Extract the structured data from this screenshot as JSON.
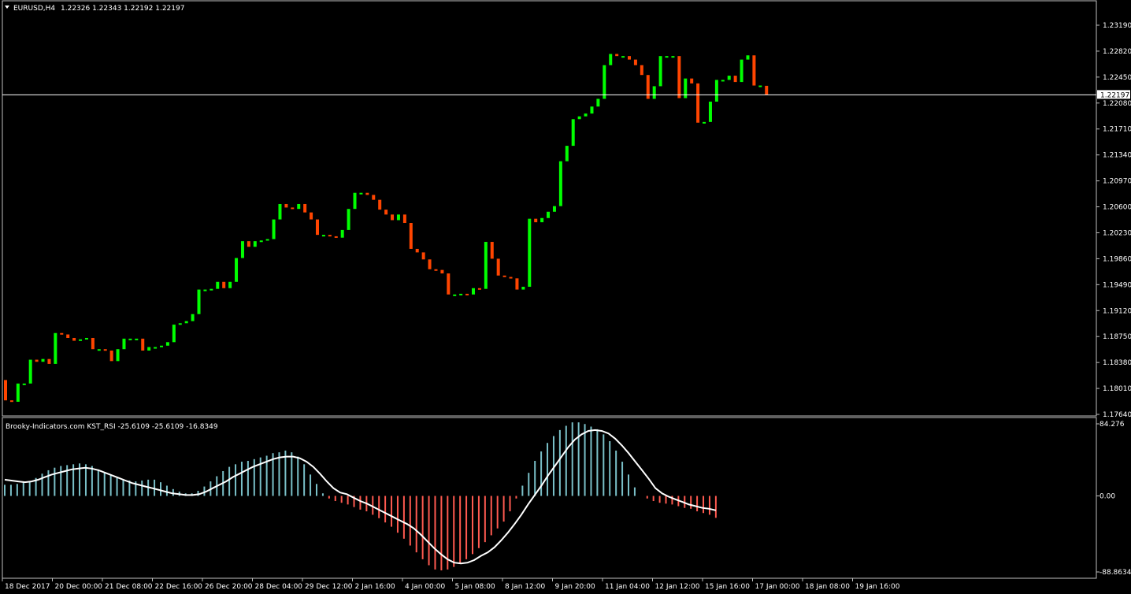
{
  "header": {
    "symbol_label": "EURUSD,H4",
    "ohlc": "1.22326 1.22343 1.22192 1.22197"
  },
  "indicator": {
    "label": "Brooky-Indicators.com KST_RSI -25.6109 -25.6109 -16.8349"
  },
  "current_price_label": "1.22197",
  "colors": {
    "background": "#000000",
    "frame": "#c0c0c0",
    "bull": "#00ff00",
    "bear": "#ff4500",
    "hist_pos": "#7ac0c8",
    "hist_neg": "#ff5a50",
    "signal": "#ffffff",
    "text": "#ffffff"
  },
  "icons": {
    "menu": "triangle-down-icon"
  },
  "chart_data": [
    {
      "type": "candlestick",
      "title": "EURUSD,H4",
      "ylim": [
        1.1764,
        1.2319
      ],
      "y_ticks": [
        "1.23190",
        "1.22820",
        "1.22450",
        "1.22080",
        "1.21710",
        "1.21340",
        "1.20970",
        "1.20600",
        "1.20230",
        "1.19860",
        "1.19490",
        "1.19120",
        "1.18750",
        "1.18380",
        "1.18010",
        "1.17640"
      ],
      "x_ticks": [
        "18 Dec 2017",
        "20 Dec 00:00",
        "21 Dec 08:00",
        "22 Dec 16:00",
        "26 Dec 20:00",
        "28 Dec 04:00",
        "29 Dec 12:00",
        "2 Jan 16:00",
        "4 Jan 00:00",
        "5 Jan 08:00",
        "8 Jan 12:00",
        "9 Jan 20:00",
        "11 Jan 04:00",
        "12 Jan 12:00",
        "15 Jan 16:00",
        "17 Jan 00:00",
        "18 Jan 08:00",
        "19 Jan 16:00"
      ],
      "current_price": 1.22197,
      "grid": false,
      "closes": [
        1.1784,
        1.1782,
        1.1808,
        1.1808,
        1.1842,
        1.1839,
        1.1843,
        1.1836,
        1.188,
        1.1878,
        1.1873,
        1.1869,
        1.1871,
        1.1873,
        1.1857,
        1.1857,
        1.1855,
        1.184,
        1.1857,
        1.1872,
        1.1872,
        1.1872,
        1.1855,
        1.186,
        1.186,
        1.1862,
        1.1867,
        1.1892,
        1.1894,
        1.1897,
        1.1907,
        1.1942,
        1.1942,
        1.1943,
        1.1953,
        1.1944,
        1.1953,
        1.1987,
        1.2011,
        1.2003,
        1.2011,
        1.2012,
        1.2014,
        1.2042,
        1.2064,
        1.2059,
        1.2057,
        1.2064,
        1.2052,
        1.2042,
        1.202,
        1.202,
        1.2018,
        1.2016,
        1.2027,
        1.2057,
        1.208,
        1.208,
        1.2077,
        1.207,
        1.2056,
        1.2049,
        1.2041,
        1.2049,
        1.2037,
        1.2,
        1.1995,
        1.1985,
        1.1971,
        1.197,
        1.1965,
        1.1935,
        1.1935,
        1.1936,
        1.1935,
        1.1944,
        1.1943,
        1.201,
        1.1986,
        1.1962,
        1.196,
        1.1958,
        1.1942,
        1.1946,
        1.2043,
        1.2038,
        1.2044,
        1.2053,
        1.2061,
        1.2125,
        1.2147,
        1.2185,
        1.2189,
        1.2193,
        1.2203,
        1.2214,
        1.2262,
        1.2278,
        1.2275,
        1.2275,
        1.227,
        1.2262,
        1.2248,
        1.2214,
        1.2232,
        1.2275,
        1.2275,
        1.2275,
        1.2215,
        1.2243,
        1.2236,
        1.218,
        1.2181,
        1.221,
        1.2241,
        1.2241,
        1.2247,
        1.2238,
        1.227,
        1.2276,
        1.2233,
        1.2233,
        1.222
      ],
      "last_bar": {
        "open": 1.22326,
        "high": 1.22343,
        "low": 1.22192,
        "close": 1.22197
      }
    },
    {
      "type": "bar",
      "title": "Brooky-Indicators.com KST_RSI",
      "ylim": [
        -88.8634,
        84.276
      ],
      "y_ticks": [
        "84.276",
        "0.00",
        "-88.8634"
      ],
      "series": [
        {
          "name": "KST_RSI",
          "values": [
            13,
            13,
            14,
            16,
            17,
            21,
            26,
            30,
            33,
            35,
            36,
            37,
            38,
            37,
            35,
            31,
            28,
            24,
            21,
            19,
            18,
            17,
            18,
            19,
            19,
            16,
            12,
            8,
            5,
            3,
            3,
            6,
            11,
            17,
            23,
            29,
            34,
            37,
            40,
            41,
            43,
            45,
            47,
            50,
            51,
            53,
            51,
            46,
            37,
            25,
            14,
            3,
            -3,
            -6,
            -8,
            -10,
            -13,
            -16,
            -18,
            -22,
            -26,
            -31,
            -36,
            -43,
            -50,
            -58,
            -66,
            -74,
            -81,
            -86,
            -87,
            -86,
            -83,
            -79,
            -74,
            -68,
            -61,
            -54,
            -46,
            -38,
            -30,
            -18,
            -3,
            12,
            27,
            41,
            52,
            62,
            70,
            77,
            82,
            86,
            86,
            84,
            81,
            78,
            72,
            64,
            53,
            40,
            25,
            10,
            0,
            -3,
            -6,
            -8,
            -9,
            -10,
            -12,
            -14,
            -15,
            -18,
            -20,
            -22,
            -25.61
          ]
        },
        {
          "name": "",
          "values": [
            19,
            18,
            17,
            16,
            17,
            19,
            22,
            25,
            27,
            29,
            31,
            32,
            33,
            32,
            30,
            27,
            24,
            21,
            18,
            15,
            13,
            11,
            9,
            7,
            5,
            3,
            2,
            1,
            1,
            2,
            5,
            9,
            13,
            17,
            22,
            26,
            30,
            34,
            37,
            40,
            43,
            45,
            46,
            46,
            44,
            40,
            34,
            26,
            17,
            9,
            4,
            2,
            -2,
            -6,
            -9,
            -13,
            -17,
            -21,
            -25,
            -29,
            -33,
            -38,
            -45,
            -53,
            -61,
            -68,
            -74,
            -78,
            -79,
            -78,
            -75,
            -70,
            -66,
            -60,
            -52,
            -43,
            -33,
            -22,
            -10,
            1,
            12,
            24,
            35,
            46,
            57,
            66,
            72,
            76,
            77,
            76,
            73,
            67,
            59,
            50,
            40,
            30,
            20,
            9,
            3,
            -1,
            -4,
            -7,
            -10,
            -12,
            -14,
            -15,
            -16.83
          ]
        }
      ]
    }
  ]
}
